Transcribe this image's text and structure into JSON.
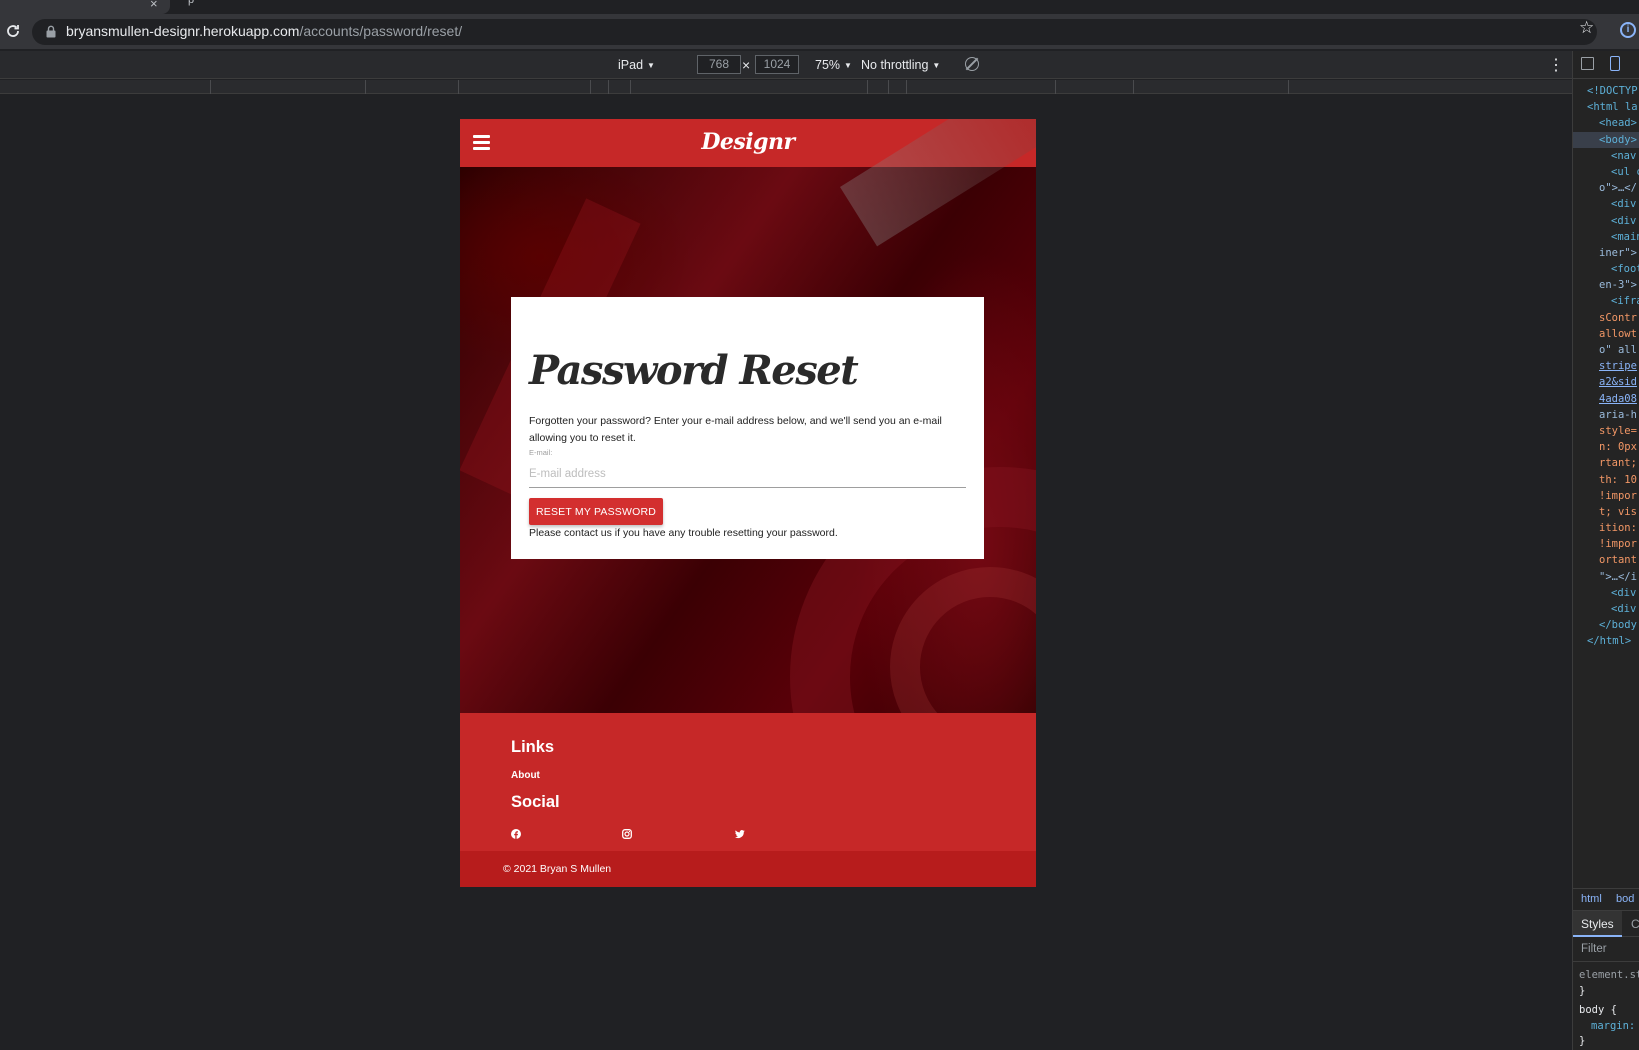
{
  "browser": {
    "url_host": "bryansmullen-designr.herokuapp.com",
    "url_path": "/accounts/password/reset/",
    "tab_close": "×",
    "tab_next": "p"
  },
  "device_toolbar": {
    "device": "iPad",
    "width": "768",
    "height": "1024",
    "times": "×",
    "zoom": "75%",
    "throttling": "No throttling"
  },
  "site": {
    "brand": "Designr",
    "card": {
      "title": "Password Reset",
      "description": "Forgotten your password? Enter your e-mail address below, and we'll send you an e-mail allowing you to reset it.",
      "email_label": "E-mail:",
      "email_placeholder": "E-mail address",
      "email_value": "",
      "button_label": "RESET MY PASSWORD",
      "contact_note": "Please contact us if you have any trouble resetting your password."
    },
    "footer": {
      "links_heading": "Links",
      "about_link": "About",
      "social_heading": "Social",
      "social_icons": [
        "facebook-icon",
        "instagram-icon",
        "twitter-icon"
      ],
      "copyright": "© 2021 Bryan S Mullen"
    },
    "colors": {
      "primary_red": "#c62828",
      "button_red": "#d32f2f",
      "footer_copyright_red": "#b71c1c"
    }
  },
  "devtools": {
    "code_lines": [
      "<!DOCTYP",
      "<html la",
      "<head>",
      "<body>",
      "<nav",
      "<ul c",
      "o\">…</",
      "<div",
      "<div",
      "<main",
      "iner\">",
      "<foot",
      "en-3\">",
      "<ifra",
      "sContr",
      "allowt",
      "o\" all",
      "stripe",
      "a2&sid",
      "4ada08",
      "aria-h",
      "style=",
      "n: 0px",
      "rtant;",
      "th: 10",
      "!impor",
      "t; vis",
      "ition:",
      "!impor",
      "ortant",
      "\">…</i",
      "<div",
      "<div",
      "</body",
      "</html>"
    ],
    "crumbs": [
      "html",
      "bod"
    ],
    "styles_tab": "Styles",
    "other_tab": "C",
    "filter_placeholder": "Filter",
    "styles_lines": [
      "element.st",
      "}",
      "body {",
      "margin:",
      "}"
    ]
  }
}
